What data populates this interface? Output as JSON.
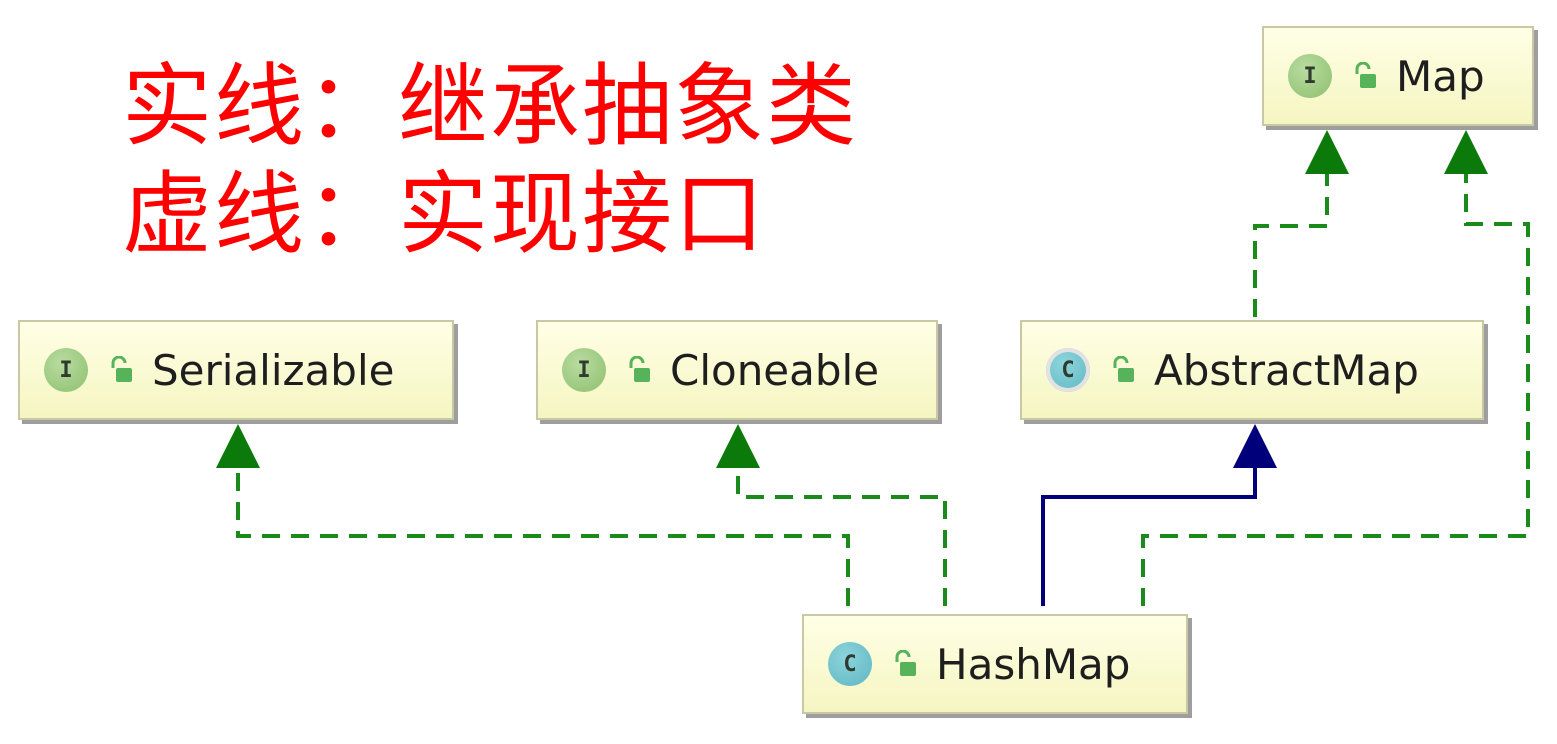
{
  "legend": {
    "solid": "实线：继承抽象类",
    "dashed": "虚线：实现接口"
  },
  "colors": {
    "legend_text": "#ff0000",
    "implements_edge": "#1a8a1a",
    "extends_edge": "#00007a",
    "node_fill": "#ffffe0",
    "interface_badge": "#8dbf6e",
    "class_badge": "#5cb6c2"
  },
  "nodes": {
    "map": {
      "name": "Map",
      "kind": "interface",
      "badge": "I",
      "visibility_icon": "unlock-icon"
    },
    "serializable": {
      "name": "Serializable",
      "kind": "interface",
      "badge": "I",
      "visibility_icon": "unlock-icon"
    },
    "cloneable": {
      "name": "Cloneable",
      "kind": "interface",
      "badge": "I",
      "visibility_icon": "unlock-icon"
    },
    "abstract_map": {
      "name": "AbstractMap",
      "kind": "abstract-class",
      "badge": "C",
      "visibility_icon": "unlock-icon"
    },
    "hash_map": {
      "name": "HashMap",
      "kind": "class",
      "badge": "C",
      "visibility_icon": "unlock-icon"
    }
  },
  "edges": [
    {
      "from": "HashMap",
      "to": "Serializable",
      "style": "dashed"
    },
    {
      "from": "HashMap",
      "to": "Cloneable",
      "style": "dashed"
    },
    {
      "from": "HashMap",
      "to": "AbstractMap",
      "style": "solid"
    },
    {
      "from": "HashMap",
      "to": "Map",
      "style": "dashed"
    },
    {
      "from": "AbstractMap",
      "to": "Map",
      "style": "dashed"
    }
  ]
}
